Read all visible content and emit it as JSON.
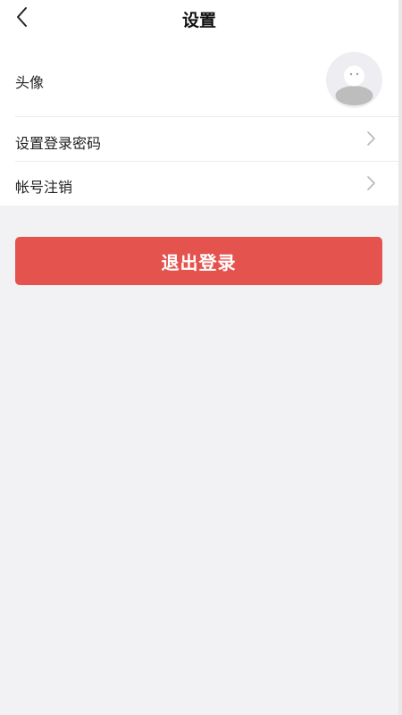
{
  "header": {
    "title": "设置",
    "back_icon": "chevron-left-icon"
  },
  "settings": {
    "avatar_row": {
      "label": "头像",
      "icon": "default-avatar-icon"
    },
    "password_row": {
      "label": "设置登录密码",
      "icon": "chevron-right-icon"
    },
    "deactivate_row": {
      "label": "帐号注销",
      "icon": "chevron-right-icon"
    }
  },
  "logout_button": {
    "label": "退出登录",
    "color": "#e5534f"
  },
  "colors": {
    "background": "#f2f2f4",
    "card": "#ffffff",
    "divider": "#ececec",
    "avatar_bg": "#eeeef2",
    "avatar_figure": "#bdbdbd"
  }
}
